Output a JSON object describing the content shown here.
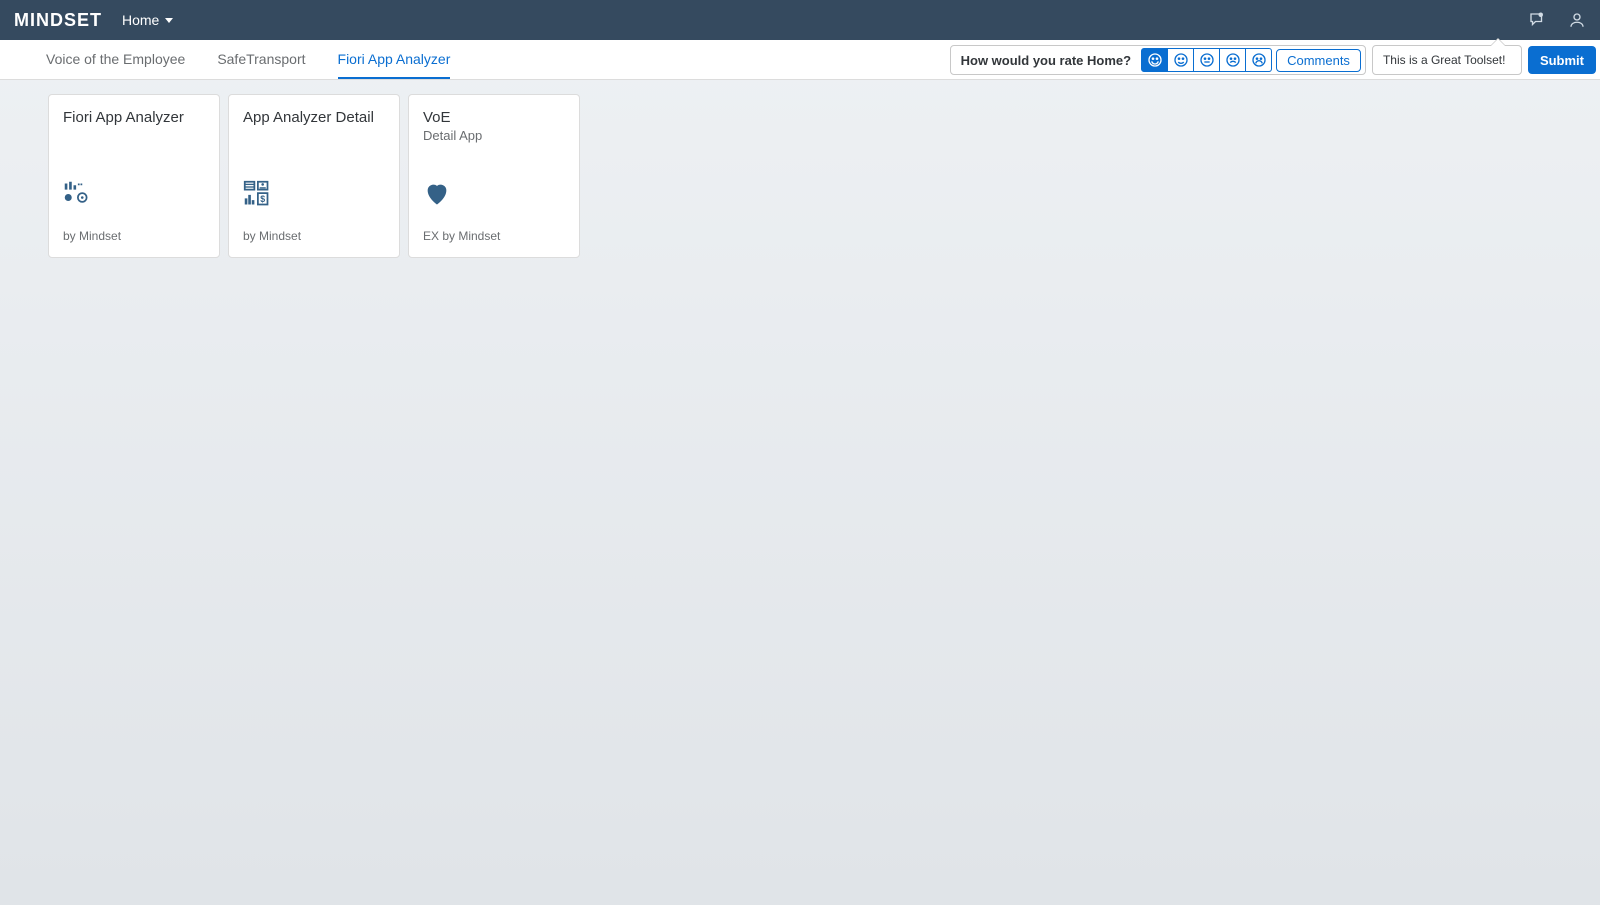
{
  "header": {
    "brand": "MINDSET",
    "nav_label": "Home"
  },
  "tabs": [
    {
      "label": "Voice of the Employee",
      "active": false
    },
    {
      "label": "SafeTransport",
      "active": false
    },
    {
      "label": "Fiori App Analyzer",
      "active": true
    }
  ],
  "rating_bar": {
    "question": "How would you rate Home?",
    "comments_label": "Comments",
    "comment_text": "This is a Great Toolset!",
    "submit_label": "Submit",
    "selected_index": 0
  },
  "tiles": [
    {
      "title": "Fiori App Analyzer",
      "subtitle": "",
      "footer": "by Mindset",
      "icon": "dashboard-icon"
    },
    {
      "title": "App Analyzer Detail",
      "subtitle": "",
      "footer": "by Mindset",
      "icon": "grid-icon"
    },
    {
      "title": "VoE",
      "subtitle": "Detail App",
      "footer": "EX by Mindset",
      "icon": "heart-icon"
    }
  ]
}
